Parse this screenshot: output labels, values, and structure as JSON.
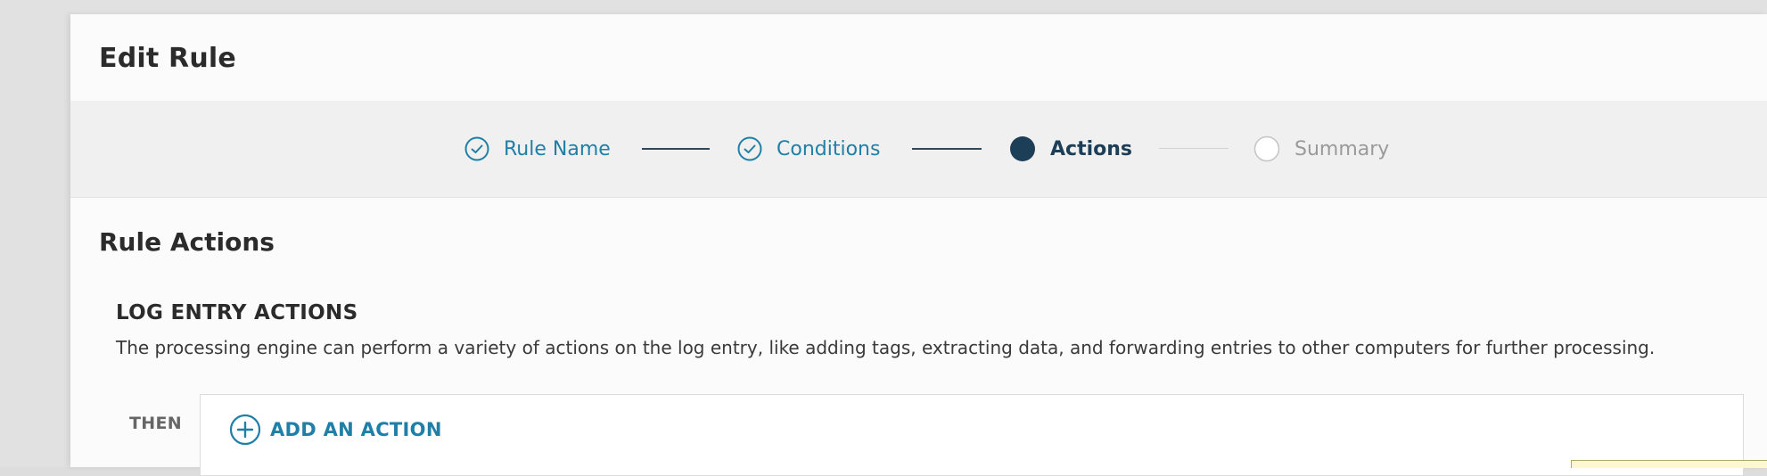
{
  "modal": {
    "title": "Edit Rule"
  },
  "stepper": {
    "steps": [
      {
        "label": "Rule Name",
        "state": "completed",
        "icon": "check-circle-icon"
      },
      {
        "label": "Conditions",
        "state": "completed",
        "icon": "check-circle-icon"
      },
      {
        "label": "Actions",
        "state": "active",
        "icon": "filled-circle-icon"
      },
      {
        "label": "Summary",
        "state": "pending",
        "icon": "empty-circle-icon"
      }
    ]
  },
  "section": {
    "title": "Rule Actions",
    "subheading": "LOG ENTRY ACTIONS",
    "description": "The processing engine can perform a variety of actions on the log entry, like adding tags, extracting data, and forwarding entries to other computers for further processing."
  },
  "actions": {
    "then_label": "THEN",
    "add_label": "ADD AN ACTION",
    "add_icon": "plus-circle-icon"
  },
  "colors": {
    "accent": "#1f7fa6",
    "active_step": "#1d3e57",
    "pending_step": "#9a9a9a"
  }
}
